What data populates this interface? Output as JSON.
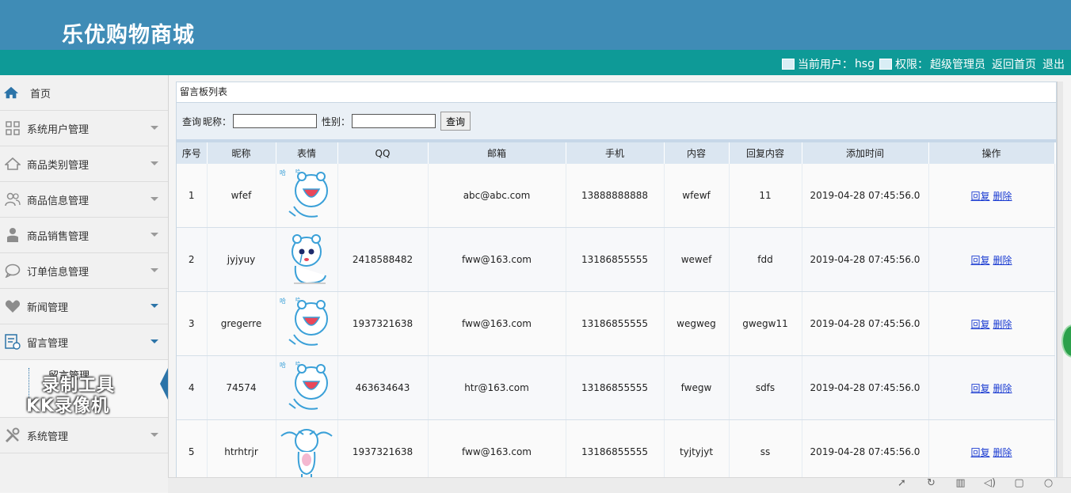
{
  "header": {
    "title": "乐优购物商城"
  },
  "userbar": {
    "current_user_label": "当前用户：",
    "current_user": "hsg",
    "role_label": "权限：",
    "role": "超级管理员",
    "home_link": "返回首页",
    "logout_link": "退出"
  },
  "sidebar": {
    "items": [
      {
        "label": "首页",
        "icon": "home-icon"
      },
      {
        "label": "系统用户管理",
        "icon": "grid-icon"
      },
      {
        "label": "商品类别管理",
        "icon": "house-icon"
      },
      {
        "label": "商品信息管理",
        "icon": "users-icon"
      },
      {
        "label": "商品销售管理",
        "icon": "person-icon"
      },
      {
        "label": "订单信息管理",
        "icon": "chat-icon"
      },
      {
        "label": "新闻管理",
        "icon": "heart-icon"
      },
      {
        "label": "留言管理",
        "icon": "message-board-icon"
      }
    ],
    "sub_item": "留言管理",
    "last_item": {
      "label": "系统管理",
      "icon": "tools-icon"
    }
  },
  "watermark": {
    "line1": "录制工具",
    "line2": "KK录像机"
  },
  "panel": {
    "title": "留言板列表"
  },
  "search": {
    "label": "查询",
    "nickname_label": "昵称：",
    "gender_label": "性别：",
    "button": "查询"
  },
  "table": {
    "headers": [
      "序号",
      "昵称",
      "表情",
      "QQ",
      "邮箱",
      "手机",
      "内容",
      "回复内容",
      "添加时间",
      "操作"
    ],
    "rows": [
      {
        "no": "1",
        "nickname": "wfef",
        "face": "laughing-bear-icon",
        "qq": "",
        "email": "abc@abc.com",
        "phone": "13888888888",
        "content": "wfewf",
        "reply": "11",
        "time": "2019-04-28 07:45:56.0"
      },
      {
        "no": "2",
        "nickname": "jyjyuy",
        "face": "crying-bear-icon",
        "qq": "2418588482",
        "email": "fww@163.com",
        "phone": "13186855555",
        "content": "wewef",
        "reply": "fdd",
        "time": "2019-04-28 07:45:56.0"
      },
      {
        "no": "3",
        "nickname": "gregerre",
        "face": "laughing-bear-icon",
        "qq": "1937321638",
        "email": "fww@163.com",
        "phone": "13186855555",
        "content": "wegweg",
        "reply": "gwegw11",
        "time": "2019-04-28 07:45:56.0"
      },
      {
        "no": "4",
        "nickname": "74574",
        "face": "laughing-bear-icon",
        "qq": "463634643",
        "email": "htr@163.com",
        "phone": "13186855555",
        "content": "fwegw",
        "reply": "sdfs",
        "time": "2019-04-28 07:45:56.0"
      },
      {
        "no": "5",
        "nickname": "htrhtrjr",
        "face": "jumping-bear-icon",
        "qq": "1937321638",
        "email": "fww@163.com",
        "phone": "13186855555",
        "content": "tyjtyjyt",
        "reply": "ss",
        "time": "2019-04-28 07:45:56.0"
      }
    ],
    "action_reply": "回复",
    "action_delete": "删除"
  },
  "colors": {
    "banner": "#3f8cb6",
    "userbar": "#0e9a97",
    "accent": "#2c74a8"
  }
}
